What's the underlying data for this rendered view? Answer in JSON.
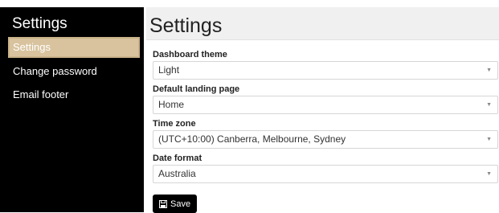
{
  "sidebar": {
    "title": "Settings",
    "items": [
      {
        "label": "Settings",
        "active": true
      },
      {
        "label": "Change password",
        "active": false
      },
      {
        "label": "Email footer",
        "active": false
      }
    ]
  },
  "main": {
    "title": "Settings",
    "fields": [
      {
        "label": "Dashboard theme",
        "value": "Light"
      },
      {
        "label": "Default landing page",
        "value": "Home"
      },
      {
        "label": "Time zone",
        "value": "(UTC+10:00) Canberra, Melbourne, Sydney"
      },
      {
        "label": "Date format",
        "value": "Australia"
      }
    ],
    "save_label": "Save"
  },
  "colors": {
    "sidebar_bg": "#000000",
    "active_item_bg": "#d8c39e",
    "main_bg": "#f0f0f0"
  },
  "icons": {
    "select_caret": "chevron-down-icon",
    "save": "floppy-disk-icon"
  }
}
